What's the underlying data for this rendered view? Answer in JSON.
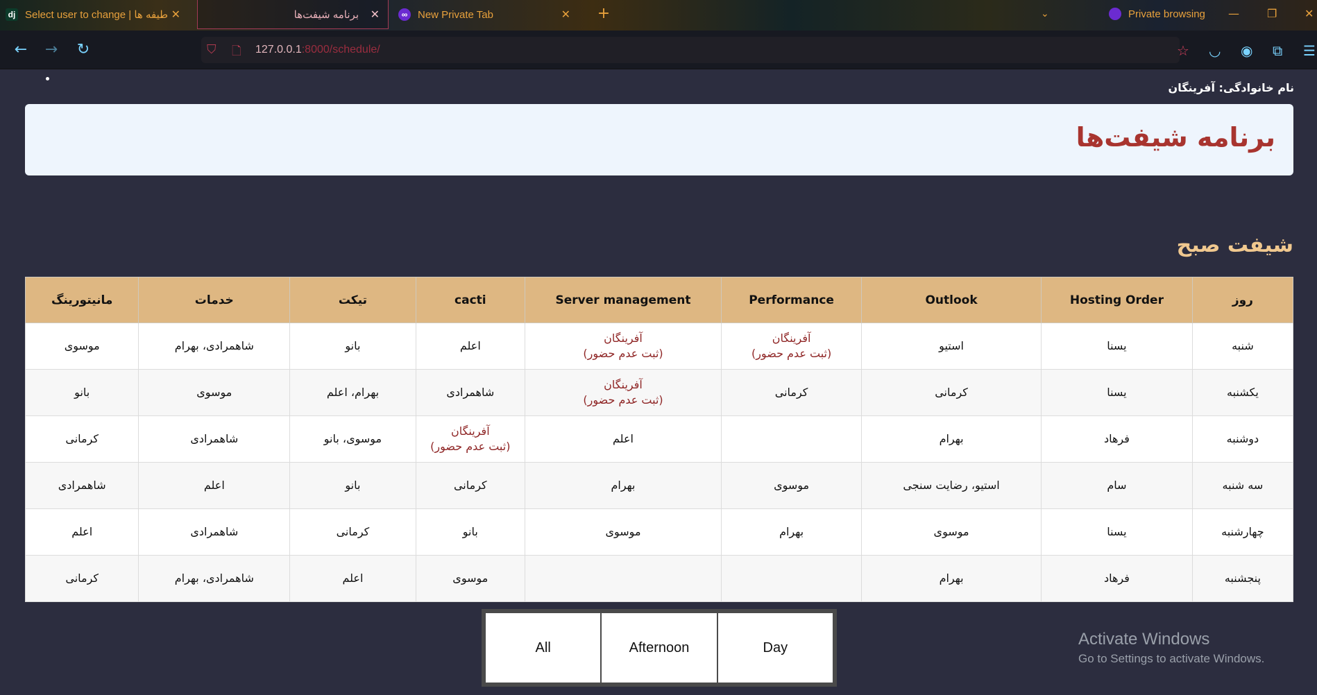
{
  "browser": {
    "tabs": [
      {
        "label": "Select user to change | طیفه ها",
        "icon": "django-icon"
      },
      {
        "label": "برنامه شیفت‌ها"
      },
      {
        "label": "New Private Tab",
        "icon": "private-mask-icon"
      }
    ],
    "private_label": "Private browsing",
    "url_host": "127.0.0.1",
    "url_rest": ":8000/schedule/"
  },
  "page": {
    "family_label": "نام خانوادگی: آفرینگان",
    "title": "برنامه شیفت‌ها",
    "shift_title": "شیفت صبح"
  },
  "table": {
    "headers": [
      "روز",
      "Hosting Order",
      "Outlook",
      "Performance",
      "Server management",
      "cacti",
      "تیکت",
      "خدمات",
      "مانیتورینگ"
    ],
    "rows": [
      [
        {
          "t": "شنبه"
        },
        {
          "t": "یسنا"
        },
        {
          "t": "استیو"
        },
        {
          "t": "آفرینگان",
          "absent": "(ثبت عدم حضور)"
        },
        {
          "t": "آفرینگان",
          "absent": "(ثبت عدم حضور)"
        },
        {
          "t": "اعلم"
        },
        {
          "t": "بانو"
        },
        {
          "t": "شاهمرادی، بهرام"
        },
        {
          "t": "موسوی"
        }
      ],
      [
        {
          "t": "یکشنبه"
        },
        {
          "t": "یسنا"
        },
        {
          "t": "کرمانی"
        },
        {
          "t": "کرمانی"
        },
        {
          "t": "آفرینگان",
          "absent": "(ثبت عدم حضور)"
        },
        {
          "t": "شاهمرادی"
        },
        {
          "t": "بهرام، اعلم"
        },
        {
          "t": "موسوی"
        },
        {
          "t": "بانو"
        }
      ],
      [
        {
          "t": "دوشنبه"
        },
        {
          "t": "فرهاد"
        },
        {
          "t": "بهرام"
        },
        {
          "t": ""
        },
        {
          "t": "اعلم"
        },
        {
          "t": "آفرینگان",
          "absent": "(ثبت عدم حضور)"
        },
        {
          "t": "موسوی، بانو"
        },
        {
          "t": "شاهمرادی"
        },
        {
          "t": "کرمانی"
        }
      ],
      [
        {
          "t": "سه شنبه"
        },
        {
          "t": "سام"
        },
        {
          "t": "استیو، رضایت سنجی"
        },
        {
          "t": "موسوی"
        },
        {
          "t": "بهرام"
        },
        {
          "t": "کرمانی"
        },
        {
          "t": "بانو"
        },
        {
          "t": "اعلم"
        },
        {
          "t": "شاهمرادی"
        }
      ],
      [
        {
          "t": "چهارشنبه"
        },
        {
          "t": "یسنا"
        },
        {
          "t": "موسوی"
        },
        {
          "t": "بهرام"
        },
        {
          "t": "موسوی"
        },
        {
          "t": "بانو"
        },
        {
          "t": "کرمانی"
        },
        {
          "t": "شاهمرادی"
        },
        {
          "t": "اعلم"
        }
      ],
      [
        {
          "t": "پنجشنبه"
        },
        {
          "t": "فرهاد"
        },
        {
          "t": "بهرام"
        },
        {
          "t": ""
        },
        {
          "t": ""
        },
        {
          "t": "موسوی"
        },
        {
          "t": "اعلم"
        },
        {
          "t": "شاهمرادی، بهرام"
        },
        {
          "t": "کرمانی"
        }
      ]
    ]
  },
  "filters": [
    "All",
    "Afternoon",
    "Day"
  ],
  "watermark": {
    "line1": "Activate Windows",
    "line2": "Go to Settings to activate Windows."
  }
}
